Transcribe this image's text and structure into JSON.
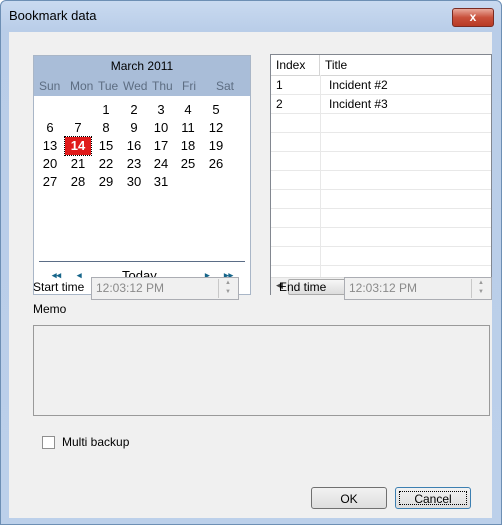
{
  "window": {
    "title": "Bookmark data",
    "close_glyph": "x"
  },
  "calendar": {
    "month_label": "March 2011",
    "weekdays": [
      "Sun",
      "Mon",
      "Tue",
      "Wed",
      "Thu",
      "Fri",
      "Sat"
    ],
    "weeks": [
      [
        "",
        "",
        "1",
        "2",
        "3",
        "4",
        "5"
      ],
      [
        "6",
        "7",
        "8",
        "9",
        "10",
        "11",
        "12"
      ],
      [
        "13",
        "14",
        "15",
        "16",
        "17",
        "18",
        "19"
      ],
      [
        "20",
        "21",
        "22",
        "23",
        "24",
        "25",
        "26"
      ],
      [
        "27",
        "28",
        "29",
        "30",
        "31",
        "",
        ""
      ]
    ],
    "selected_day": "14",
    "today_label": "Today",
    "nav": {
      "prev_year": "◂◂",
      "prev_month": "◂",
      "next_month": "▸",
      "next_year": "▸▸"
    }
  },
  "bookmarks": {
    "columns": [
      "Index",
      "Title"
    ],
    "rows": [
      {
        "index": "1",
        "title": "Incident #2"
      },
      {
        "index": "2",
        "title": "Incident #3"
      }
    ],
    "scroll_grip": "III"
  },
  "start_time": {
    "label": "Start time",
    "value": "12:03:12 PM"
  },
  "end_time": {
    "label": "End time",
    "value": "12:03:12 PM"
  },
  "memo": {
    "label": "Memo",
    "value": ""
  },
  "multi_backup": {
    "label": "Multi backup",
    "checked": false
  },
  "buttons": {
    "ok": "OK",
    "cancel": "Cancel"
  },
  "colors": {
    "selected_day_bg": "#e01b1b",
    "calendar_header_bg": "#a9bdd8",
    "close_button": "#c9503b"
  }
}
